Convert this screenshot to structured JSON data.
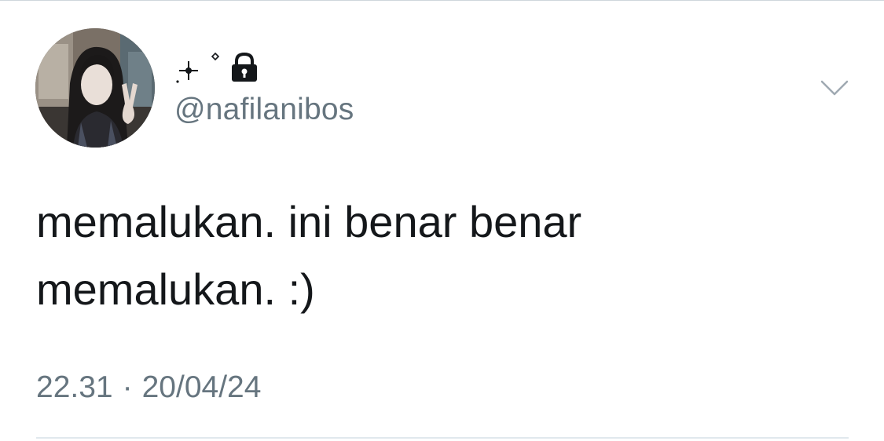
{
  "tweet": {
    "display_name_icons": [
      "sparkle-icon",
      "lock-icon"
    ],
    "handle": "@nafilanibos",
    "text_lines": [
      "memalukan. ini benar benar",
      "memalukan. :)"
    ],
    "time": "22.31",
    "separator": "·",
    "date": "20/04/24"
  },
  "colors": {
    "text": "#14171a",
    "secondary": "#66757f",
    "divider": "#e1e8ed"
  }
}
